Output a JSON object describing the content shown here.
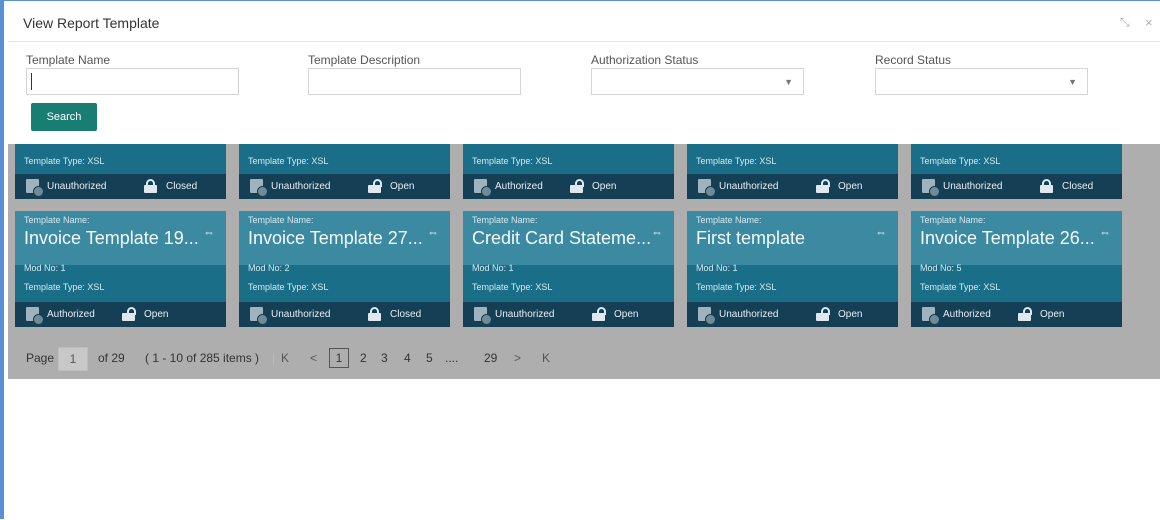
{
  "window": {
    "title": "View Report Template",
    "minimize_glyph": "⤡",
    "close_glyph": "×"
  },
  "search": {
    "template_name_label": "Template Name",
    "template_name_value": "",
    "template_description_label": "Template Description",
    "template_description_value": "",
    "authorization_status_label": "Authorization Status",
    "authorization_status_value": "",
    "record_status_label": "Record Status",
    "record_status_value": "",
    "dropdown_glyph": "▼",
    "search_button": "Search"
  },
  "labels": {
    "template_name": "Template Name:",
    "template_type_prefix": "Template Type: ",
    "mod_no_prefix": "Mod No: "
  },
  "cards_row1": [
    {
      "template_type": "XSL",
      "auth_status": "Unauthorized",
      "record_status": "Closed"
    },
    {
      "template_type": "XSL",
      "auth_status": "Unauthorized",
      "record_status": "Open"
    },
    {
      "template_type": "XSL",
      "auth_status": "Authorized",
      "record_status": "Open"
    },
    {
      "template_type": "XSL",
      "auth_status": "Unauthorized",
      "record_status": "Open"
    },
    {
      "template_type": "XSL",
      "auth_status": "Unauthorized",
      "record_status": "Closed"
    }
  ],
  "cards_row2": [
    {
      "template_name": "Invoice Template 19...",
      "mod_no": "1",
      "template_type": "XSL",
      "auth_status": "Authorized",
      "record_status": "Open"
    },
    {
      "template_name": "Invoice Template 27...",
      "mod_no": "2",
      "template_type": "XSL",
      "auth_status": "Unauthorized",
      "record_status": "Closed"
    },
    {
      "template_name": "Credit Card Stateme...",
      "mod_no": "1",
      "template_type": "XSL",
      "auth_status": "Unauthorized",
      "record_status": "Open"
    },
    {
      "template_name": "First template",
      "mod_no": "1",
      "template_type": "XSL",
      "auth_status": "Unauthorized",
      "record_status": "Open"
    },
    {
      "template_name": "Invoice Template 26...",
      "mod_no": "5",
      "template_type": "XSL",
      "auth_status": "Authorized",
      "record_status": "Open"
    }
  ],
  "pager": {
    "page_label": "Page",
    "page_value": "1",
    "of_total": "of 29",
    "range": "( 1 - 10 of 285 items )",
    "first": "K",
    "prev": "<",
    "pages": [
      "1",
      "2",
      "3",
      "4",
      "5"
    ],
    "ellipsis": "....",
    "last_page": "29",
    "next": ">",
    "last": "K"
  },
  "colors": {
    "accent": "#187d73",
    "card_body": "#1b6e87",
    "card_header": "#3c8aa1",
    "card_footer": "#153f54",
    "overlay": "#aeaeae"
  },
  "icons": {
    "link": "link-icon",
    "auth": "document-user-icon",
    "lock_open": "unlock-icon",
    "lock_closed": "lock-icon"
  }
}
